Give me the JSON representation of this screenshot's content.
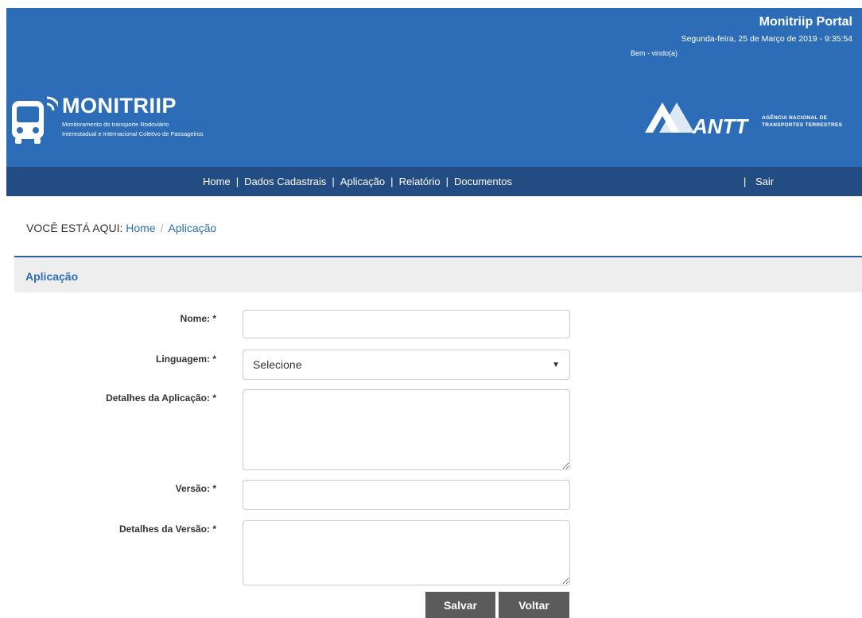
{
  "header": {
    "portal_title": "Monitriip Portal",
    "date_time": "Segunda-feira, 25 de Março de 2019 - 9:35:54",
    "welcome": "Bem - vindo(a)",
    "logo_title": "MONITRIIP",
    "logo_subtitle_1": "Monitoramento do transporte Rodoviário",
    "logo_subtitle_2": "Interestadual e Internacional Coletivo de Passageiros",
    "agency_logo_text": "ANTT",
    "agency_name_1": "AGÊNCIA NACIONAL DE",
    "agency_name_2": "TRANSPORTES TERRESTRES"
  },
  "nav": {
    "items": [
      "Home",
      "Dados Cadastrais",
      "Aplicação",
      "Relatório",
      "Documentos"
    ],
    "separator": "|",
    "logout": "Sair"
  },
  "breadcrumb": {
    "prefix": "VOCÊ ESTÁ AQUI:",
    "home": "Home",
    "separator": "/",
    "current": "Aplicação"
  },
  "section": {
    "title": "Aplicação"
  },
  "form": {
    "nome_label": "Nome: *",
    "nome_value": "",
    "linguagem_label": "Linguagem: *",
    "linguagem_value": "Selecione",
    "detalhes_aplicacao_label": "Detalhes da Aplicação: *",
    "versao_label": "Versão: *",
    "versao_value": "",
    "detalhes_versao_label": "Detalhes da Versão: *"
  },
  "buttons": {
    "save": "Salvar",
    "back": "Voltar"
  },
  "colors": {
    "header_blue": "#2d6db8",
    "nav_dark_blue": "#234d82",
    "button_gray": "#5b5b5b",
    "section_bg": "#eeeeee"
  },
  "icons": {
    "logo": "bus-icon",
    "dropdown": "caret-down-icon",
    "agency_logo": "antt-logo-icon"
  }
}
